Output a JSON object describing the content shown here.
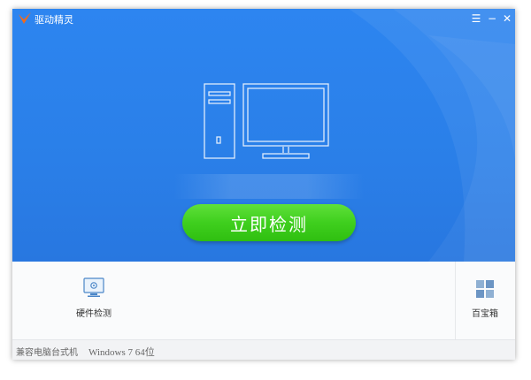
{
  "app": {
    "title": "驱动精灵"
  },
  "window_controls": {
    "menu": "☰",
    "minimize": "−",
    "close": "✕"
  },
  "main": {
    "scan_button": "立即检测"
  },
  "tools": {
    "hardware": {
      "label": "硬件检测",
      "icon": "monitor-gear-icon"
    },
    "toolbox": {
      "label": "百宝箱",
      "icon": "grid-icon"
    }
  },
  "status": {
    "model": "兼容电脑台式机",
    "os": "Windows 7 64位"
  },
  "colors": {
    "hero": "#2a7fe8",
    "button": "#3fcf1e",
    "logo": "#f06a1e"
  }
}
